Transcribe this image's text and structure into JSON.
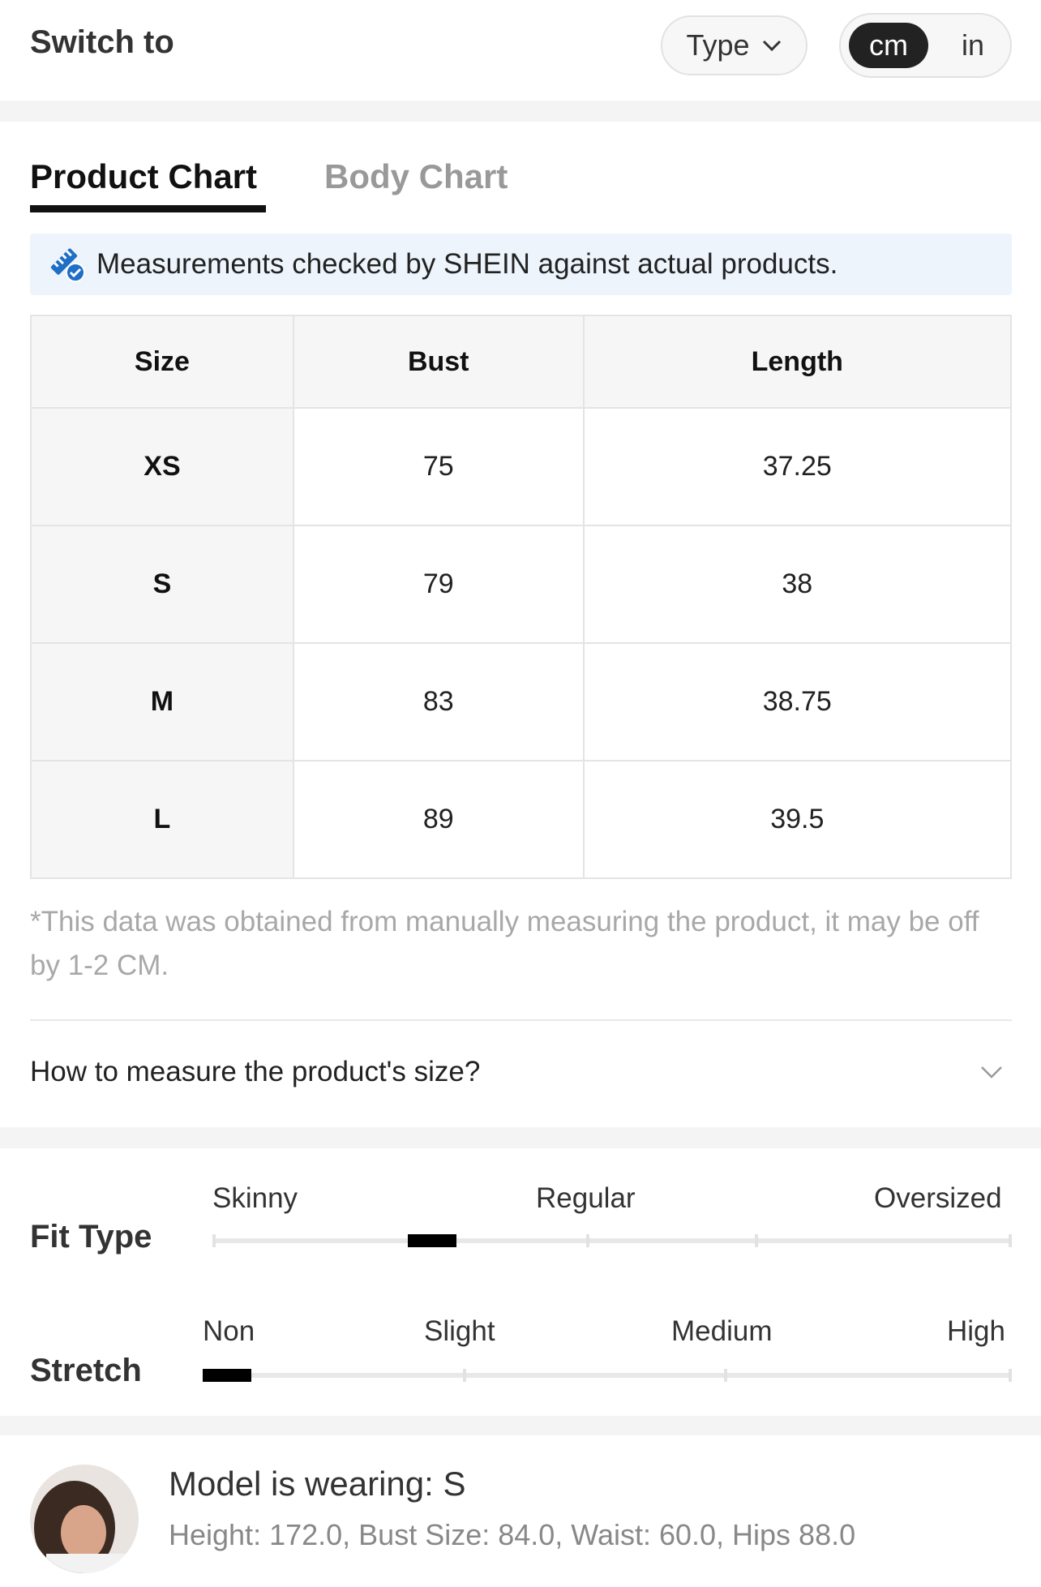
{
  "header": {
    "switch_label": "Switch to",
    "type_label": "Type",
    "units": {
      "active": "cm",
      "inactive": "in"
    }
  },
  "tabs": [
    {
      "label": "Product Chart",
      "active": true
    },
    {
      "label": "Body Chart",
      "active": false
    }
  ],
  "notice": {
    "icon": "ruler-check-icon",
    "text": "Measurements checked by SHEIN against actual products."
  },
  "size_table": {
    "headers": [
      "Size",
      "Bust",
      "Length"
    ],
    "rows": [
      [
        "XS",
        "75",
        "37.25"
      ],
      [
        "S",
        "79",
        "38"
      ],
      [
        "M",
        "83",
        "38.75"
      ],
      [
        "L",
        "89",
        "39.5"
      ]
    ]
  },
  "footnote": "*This data was obtained from manually measuring the product, it may be off by 1-2 CM.",
  "measure_question": "How to measure the product's size?",
  "fit_type": {
    "label": "Fit Type",
    "scale": [
      "Skinny",
      "Regular",
      "Oversized"
    ],
    "value_fraction": 0.26
  },
  "stretch": {
    "label": "Stretch",
    "scale": [
      "Non",
      "Slight",
      "Medium",
      "High"
    ],
    "value_fraction": 0.0
  },
  "model": {
    "wearing": "Model is wearing: S",
    "stats": "Height: 172.0,  Bust Size: 84.0,  Waist: 60.0,  Hips 88.0"
  },
  "colors": {
    "accent": "#1f6fc6",
    "notice_bg": "#edf4fc",
    "active_unit_bg": "#222222",
    "muted_text": "#a8a8a8"
  }
}
